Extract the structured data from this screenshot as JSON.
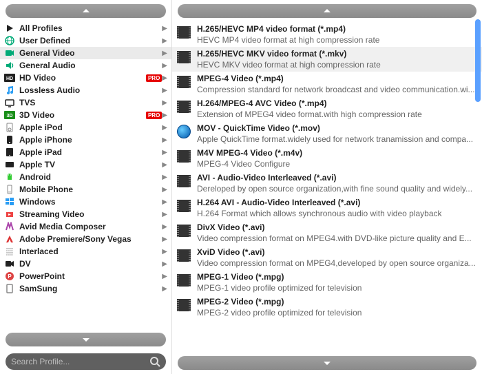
{
  "search": {
    "placeholder": "Search Profile..."
  },
  "categories": [
    {
      "label": "All Profiles",
      "icon": "play",
      "color": "#222"
    },
    {
      "label": "User Defined",
      "icon": "globe",
      "color": "#0a7"
    },
    {
      "label": "General Video",
      "icon": "video",
      "color": "#0a7",
      "selected": true
    },
    {
      "label": "General Audio",
      "icon": "audio",
      "color": "#0a7"
    },
    {
      "label": "HD Video",
      "icon": "hd",
      "color": "#222",
      "badge": "PRO"
    },
    {
      "label": "Lossless Audio",
      "icon": "music",
      "color": "#2a9df4"
    },
    {
      "label": "TVS",
      "icon": "tv",
      "color": "#222"
    },
    {
      "label": "3D Video",
      "icon": "3d",
      "color": "#1a8f1a",
      "badge": "PRO"
    },
    {
      "label": "Apple iPod",
      "icon": "ipod",
      "color": "#888"
    },
    {
      "label": "Apple iPhone",
      "icon": "iphone",
      "color": "#222"
    },
    {
      "label": "Apple iPad",
      "icon": "ipad",
      "color": "#222"
    },
    {
      "label": "Apple TV",
      "icon": "appletv",
      "color": "#222"
    },
    {
      "label": "Android",
      "icon": "android",
      "color": "#3c3"
    },
    {
      "label": "Mobile Phone",
      "icon": "mobile",
      "color": "#888"
    },
    {
      "label": "Windows",
      "icon": "windows",
      "color": "#2a9df4"
    },
    {
      "label": "Streaming Video",
      "icon": "stream",
      "color": "#e44"
    },
    {
      "label": "Avid Media Composer",
      "icon": "avid",
      "color": "#a4a"
    },
    {
      "label": "Adobe Premiere/Sony Vegas",
      "icon": "adobe",
      "color": "#d33"
    },
    {
      "label": "Interlaced",
      "icon": "interlace",
      "color": "#999"
    },
    {
      "label": "DV",
      "icon": "dv",
      "color": "#222"
    },
    {
      "label": "PowerPoint",
      "icon": "ppt",
      "color": "#d44"
    },
    {
      "label": "SamSung",
      "icon": "samsung",
      "color": "#888"
    }
  ],
  "formats": [
    {
      "title": "H.265/HEVC MP4 video format (*.mp4)",
      "desc": "HEVC MP4 video format at high compression rate",
      "icon": "film"
    },
    {
      "title": "H.265/HEVC MKV video format (*.mkv)",
      "desc": "HEVC MKV video format at high compression rate",
      "icon": "film",
      "hover": true
    },
    {
      "title": "MPEG-4 Video (*.mp4)",
      "desc": "Compression standard for network broadcast and video communication.wi...",
      "icon": "film"
    },
    {
      "title": "H.264/MPEG-4 AVC Video (*.mp4)",
      "desc": "Extension of MPEG4 video format.with high compression rate",
      "icon": "film"
    },
    {
      "title": "MOV - QuickTime Video (*.mov)",
      "desc": "Apple QuickTime format.widely used for network tranamission and compa...",
      "icon": "qt"
    },
    {
      "title": "M4V MPEG-4 Video (*.m4v)",
      "desc": "MPEG-4 Video Configure",
      "icon": "film"
    },
    {
      "title": "AVI - Audio-Video Interleaved (*.avi)",
      "desc": "Dereloped by open source organization,with fine sound quality and widely...",
      "icon": "film"
    },
    {
      "title": "H.264 AVI - Audio-Video Interleaved (*.avi)",
      "desc": "H.264 Format which allows synchronous audio with video playback",
      "icon": "film"
    },
    {
      "title": "DivX Video (*.avi)",
      "desc": "Video compression format on MPEG4.with DVD-like picture quality and E...",
      "icon": "film"
    },
    {
      "title": "XviD Video (*.avi)",
      "desc": "Video compression format on MPEG4,developed by open source organiza...",
      "icon": "film"
    },
    {
      "title": "MPEG-1 Video (*.mpg)",
      "desc": "MPEG-1 video profile optimized for television",
      "icon": "film"
    },
    {
      "title": "MPEG-2 Video (*.mpg)",
      "desc": "MPEG-2 video profile optimized for television",
      "icon": "film"
    }
  ]
}
